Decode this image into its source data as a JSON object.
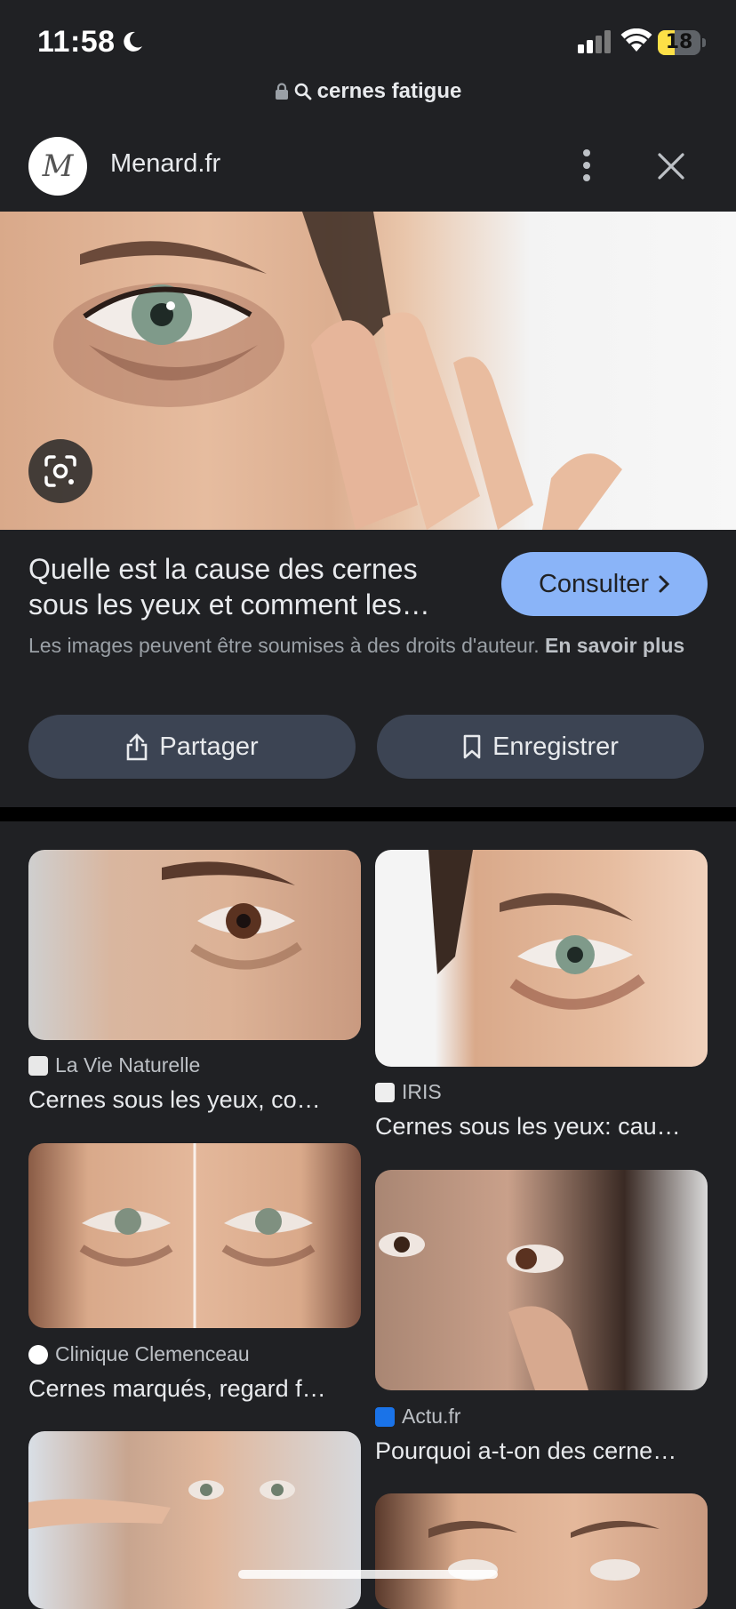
{
  "status_bar": {
    "time": "11:58",
    "battery": "18",
    "battery_level": 0.18
  },
  "url_bar": {
    "query": "cernes fatigue"
  },
  "site": {
    "name": "Menard.fr",
    "favicon_text": "M"
  },
  "result": {
    "title_line1": "Quelle est la cause des cernes",
    "title_line2": "sous les yeux et comment les…",
    "consult_label": "Consulter",
    "copyright_text": "Les images peuvent être soumises à des droits d'auteur.",
    "learn_more": "En savoir plus",
    "share_label": "Partager",
    "save_label": "Enregistrer"
  },
  "grid": {
    "left": [
      {
        "source": "La Vie Naturelle",
        "caption": "Cernes sous les yeux, co…",
        "favicon_color": "#e8e8e8"
      },
      {
        "source": "Clinique Clemenceau",
        "caption": "Cernes marqués, regard f…",
        "favicon_color": "#ffffff"
      }
    ],
    "right": [
      {
        "source": "IRIS",
        "caption": "Cernes sous les yeux: cau…",
        "favicon_color": "#eeeeee"
      },
      {
        "source": "Actu.fr",
        "caption": "Pourquoi a-t-on des cerne…",
        "favicon_color": "#1a73e8"
      }
    ]
  },
  "colors": {
    "background": "#202124",
    "accent": "#8ab4f8",
    "button_bg": "#3c4453"
  }
}
